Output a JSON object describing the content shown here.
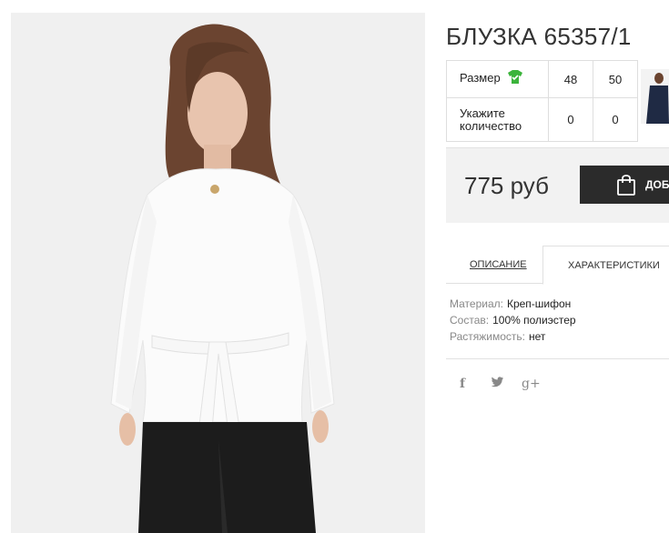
{
  "product": {
    "title": "БЛУЗКА 65357/1",
    "price": "775 руб",
    "cart_button": "ДОБ"
  },
  "size_table": {
    "size_label": "Размер",
    "quantity_label_line1": "Укажите",
    "quantity_label_line2": "количество",
    "sizes": [
      "48",
      "50"
    ],
    "quantities": [
      "0",
      "0"
    ],
    "size_icon": "t-shirt-icon"
  },
  "tabs": {
    "description": "ОПИСАНИЕ",
    "characteristics": "ХАРАКТЕРИСТИКИ"
  },
  "characteristics": [
    {
      "key": "Материал:",
      "value": "Креп-шифон"
    },
    {
      "key": "Состав:",
      "value": "100% полиэстер"
    },
    {
      "key": "Растяжимость:",
      "value": "нет"
    }
  ],
  "social": {
    "facebook": "f",
    "twitter": "🐦",
    "google": "g+"
  },
  "colors": {
    "accent_green": "#3cb43c",
    "button_dark": "#2b2b2b",
    "price_bar_bg": "#f2f2f2"
  }
}
